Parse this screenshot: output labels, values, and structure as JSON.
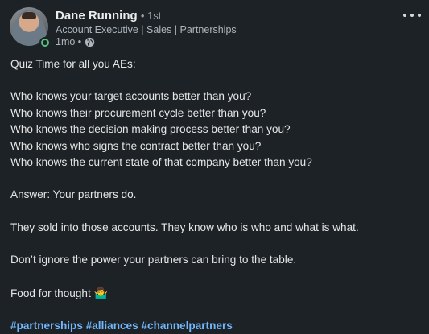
{
  "post": {
    "author": {
      "name": "Dane Running",
      "degree": "• 1st",
      "headline": "Account Executive | Sales | Partnerships",
      "time": "1mo •"
    },
    "icons": {
      "visibility": "globe-icon",
      "menu": "more-options-icon",
      "presence": "online-status-icon"
    },
    "colors": {
      "background": "#1d2226",
      "link": "#71b7fb",
      "online": "#57c27c"
    },
    "body": {
      "line1": "Quiz Time for all you AEs:",
      "q1": "Who knows your target accounts better than you?",
      "q2": "Who knows their procurement cycle better than you?",
      "q3": "Who knows the decision making process better than you?",
      "q4": "Who knows who signs the contract better than you?",
      "q5": "Who knows the current state of that company better than you?",
      "answer": "Answer: Your partners do.",
      "sold": "They sold into those accounts. They know who is who and what is what.",
      "ignore": "Don’t ignore the power your partners can bring to the table.",
      "food": "Food for thought",
      "food_emoji": "🤷‍♂️"
    },
    "hashtags": [
      "#partnerships",
      "#alliances",
      "#channelpartners"
    ]
  }
}
